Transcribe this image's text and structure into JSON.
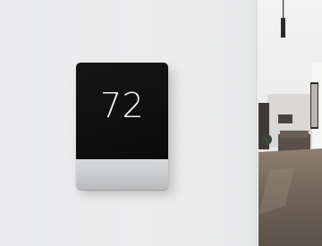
{
  "scene": {
    "colors": {
      "wall": "#ececed",
      "screen": "#0d0d0d",
      "bezel": "#cfd0d2",
      "temperature_text": "#f4f4f4"
    }
  },
  "thermostat": {
    "temperature": "72"
  }
}
